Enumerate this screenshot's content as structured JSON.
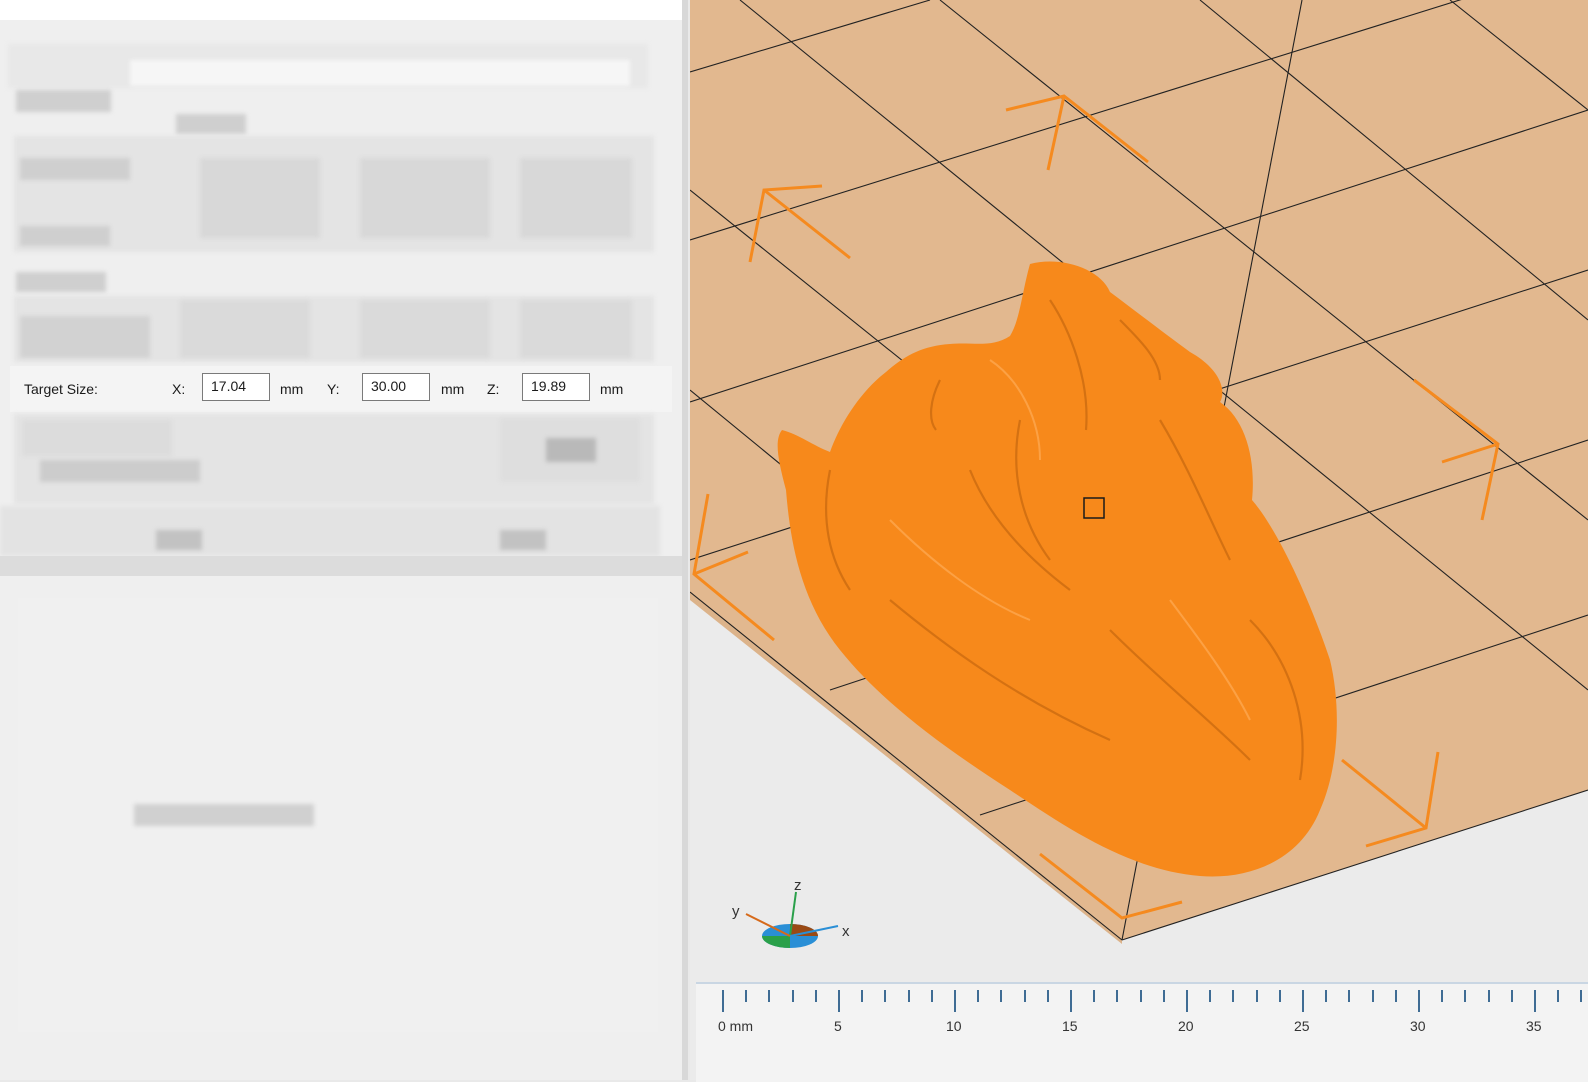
{
  "target_size": {
    "label": "Target Size:",
    "x_label": "X:",
    "x_value": "17.04",
    "y_label": "Y:",
    "y_value": "30.00",
    "z_label": "Z:",
    "z_value": "19.89",
    "unit": "mm"
  },
  "axes_gizmo": {
    "x": "x",
    "y": "y",
    "z": "z"
  },
  "ruler": {
    "labels": [
      "0 mm",
      "5",
      "10",
      "15",
      "20",
      "25",
      "30",
      "35"
    ]
  },
  "colors": {
    "model": "#f7891b",
    "build_plate": "#e2b88f",
    "selection_corners": "#f58a1f",
    "ruler_ticks": "#3f6c94"
  }
}
